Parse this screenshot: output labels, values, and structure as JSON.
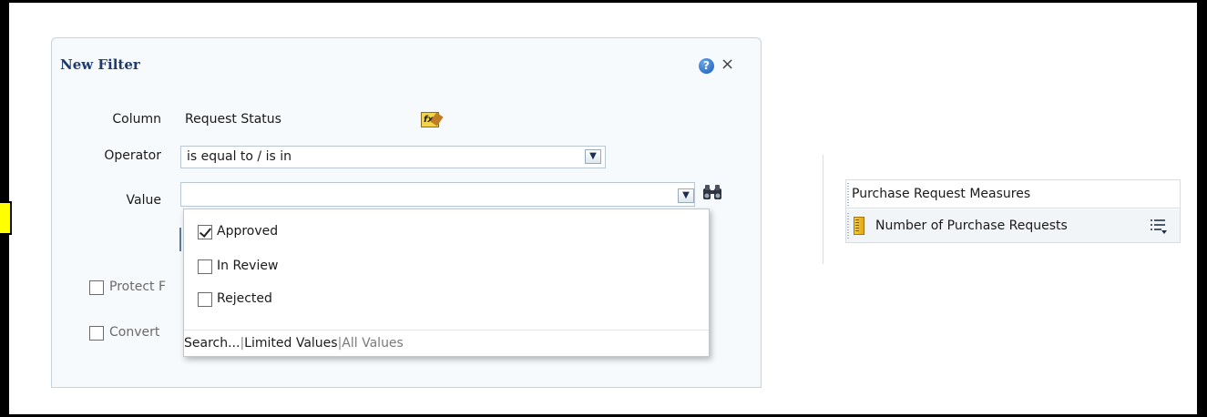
{
  "dialog": {
    "title": "New Filter",
    "help_icon": "?",
    "close_icon": "×",
    "column_label": "Column",
    "column_value": "Request Status",
    "operator_label": "Operator",
    "operator_value": "is equal to / is in",
    "value_label": "Value",
    "value_input": "",
    "protect_label": "Protect F",
    "convert_label": "Convert"
  },
  "value_dropdown": {
    "options": [
      {
        "label": "Approved",
        "checked": true
      },
      {
        "label": "In Review",
        "checked": false
      },
      {
        "label": "Rejected",
        "checked": false
      }
    ],
    "footer": {
      "search": "Search...",
      "sep1": "|",
      "limited": "Limited Values",
      "sep2": "|",
      "all": "All Values"
    }
  },
  "measures_panel": {
    "header": "Purchase Request Measures",
    "item": "Number of Purchase Requests"
  },
  "colors": {
    "title_blue": "#1f3b6e",
    "dialog_bg": "#f7fafc",
    "highlight_yellow": "#ffff00"
  },
  "icons": [
    "help-icon",
    "close-icon",
    "formula-edit-icon",
    "chevron-down-icon",
    "binoculars-search-icon",
    "ruler-measure-icon",
    "column-menu-icon"
  ]
}
